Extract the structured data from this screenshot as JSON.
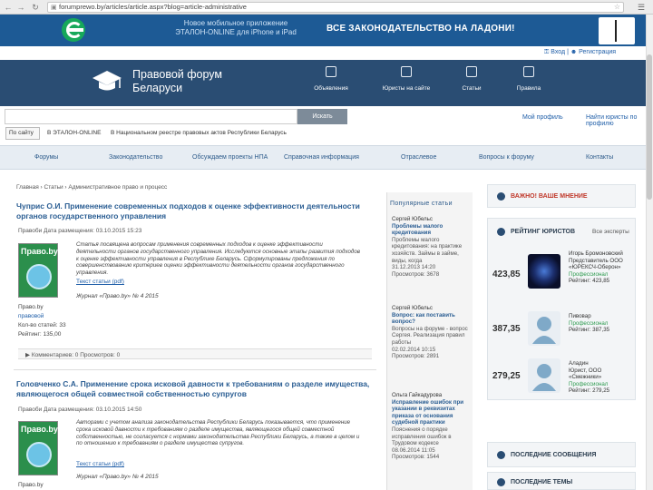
{
  "browser": {
    "url": "forumprewo.by/articles/article.aspx?blog=article-administrative",
    "back_icon": "arrow-left-icon",
    "forward_icon": "arrow-right-icon",
    "reload_icon": "reload-icon"
  },
  "banner": {
    "promo_line1": "Новое мобильное приложение",
    "promo_line2": "ЭТАЛОН-ONLINE для iPhone и iPad",
    "slogan": "ВСЕ ЗАКОНОДАТЕЛЬСТВО НА ЛАДОНИ!"
  },
  "login": {
    "enter": "Вход",
    "register": "Регистрация"
  },
  "header": {
    "title_line1": "Правовой форум",
    "title_line2": "Беларуси",
    "items": [
      {
        "label": "Объявления"
      },
      {
        "label": "Юристы на сайте"
      },
      {
        "label": "Статьи"
      },
      {
        "label": "Правила"
      }
    ]
  },
  "search": {
    "button": "Искать",
    "advanced": "Мой профиль",
    "ask": "Найти юристы по профилю",
    "scope_label": "По сайту",
    "scope_etalon": "В ЭТАЛОН-ONLINE",
    "scope_register": "В Национальном реестре правовых актов Республики Беларусь"
  },
  "nav": [
    {
      "label": "Форумы"
    },
    {
      "label": "Законодательство"
    },
    {
      "label": "Обсуждаем проекты НПА"
    },
    {
      "label": "Справочная информация"
    },
    {
      "label": "Отраслевое"
    },
    {
      "label": "Вопросы к форуму"
    },
    {
      "label": "Контакты"
    }
  ],
  "breadcrumb": "Главная  ›  Статьи  ›  Административное право и процесс",
  "articles": [
    {
      "title": "Чуприс О.И. Применение современных подходов к оценке эффективности деятельности органов государственного управления",
      "meta": "Правоби  Дата размещения: 03.10.2015 15:23",
      "cover_title": "Право.by",
      "excerpt": "Статья посвящена вопросам применения современных подходов к оценке эффективности деятельности органов государственного управления. Исследуются основные этапы развития подходов к оценке эффективности управления в Республике Беларусь. Сформулированы предложения по совершенствованию критериев оценки эффективности деятельности органов государственного управления.",
      "link": "Текст статьи (pdf)",
      "source": "Журнал «Право.by» № 4 2015",
      "side_author": "Право.by",
      "side_tag": "правовой",
      "side_stat1": "Кол-во статей: 33",
      "side_stat2": "Рейтинг: 135,00",
      "actions": "Комментариев: 0   Просмотров: 0"
    },
    {
      "title": "Головченко С.А. Применение срока исковой давности к требованиям о разделе имущества, являющегося общей совместной собственностью супругов",
      "meta": "Правоби  Дата размещения: 03.10.2015 14:50",
      "cover_title": "Право.by",
      "excerpt": "Авторами с учетом анализа законодательства Республики Беларусь показывается, что применение срока исковой давности к требованиям о разделе имущества, являющегося общей совместной собственностью, не согласуется с нормами законодательства Республики Беларусь, а также в целом и по отношению к требованиям о разделе имущества супругов.",
      "link": "Текст статьи (pdf)",
      "source": "Журнал «Право.by» № 4 2015",
      "side_author": "Право.by"
    }
  ],
  "popular": {
    "heading": "Популярные статьи",
    "items": [
      {
        "author": "Сергей Юбельс",
        "title": "Проблемы малого кредитования",
        "text": "Проблемы малого кредитования: на практике хозяйств. Займы в займе, виды, когда",
        "date": "31.12.2013 14:20",
        "stats": "Просмотров: 3678"
      },
      {
        "author": "Сергей Юбельс",
        "title": "Вопрос: как поставить вопрос?",
        "text": "Вопросы на форуме - вопрос Сергея. Реализация правил работы",
        "date": "02.02.2014 10:15",
        "stats": "Просмотров: 2891"
      },
      {
        "author": "Ольга Гайкадурова",
        "title": "Исправление ошибок при указании в реквизитах приказа от основания судебной практики",
        "text": "Пояснения о порядке исправления ошибок в Трудовом кодексе",
        "date": "08.06.2014 11:05",
        "stats": "Просмотров: 1544"
      }
    ]
  },
  "sidebar": {
    "important": "ВАЖНО! ВАШЕ МНЕНИЕ",
    "rating_title": "РЕЙТИНГ ЮРИСТОВ",
    "rating_all": "Все эксперты",
    "lawyers": [
      {
        "score": "423,85",
        "name": "Игорь Бромоновский",
        "role": "Представитель ООО «ЮРЕКСЧ-Оберон»",
        "status": "Профессионал",
        "rating": "Рейтинг: 423,85"
      },
      {
        "score": "387,35",
        "name": "Пивовар",
        "role": "",
        "status": "Профессионал",
        "rating": "Рейтинг: 387,35"
      },
      {
        "score": "279,25",
        "name": "Аладин",
        "role": "Юрист, ООО «Смежники»",
        "status": "Профессионал",
        "rating": "Рейтинг: 279,25"
      }
    ],
    "recent_messages": "ПОСЛЕДНИЕ СООБЩЕНИЯ",
    "recent_topics": "ПОСЛЕДНИЕ ТЕМЫ"
  }
}
